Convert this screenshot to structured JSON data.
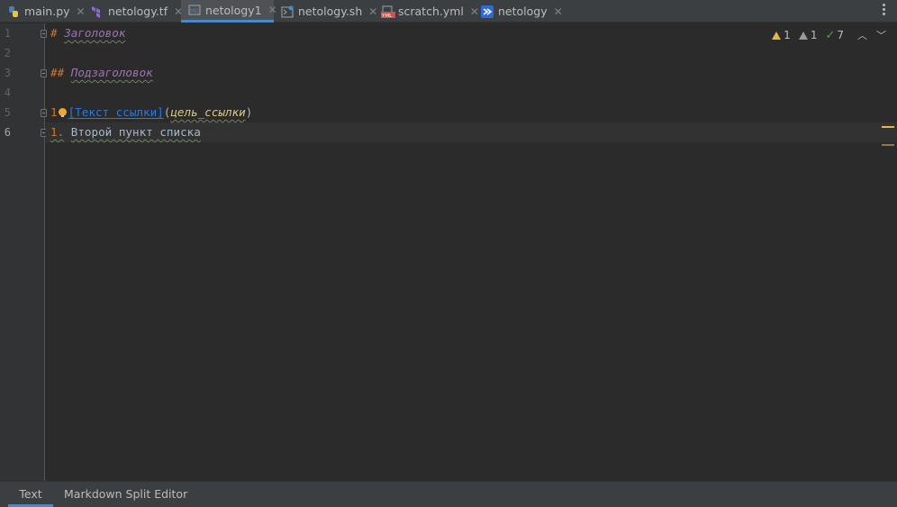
{
  "tabs": [
    {
      "label": "main.py",
      "icon": "python-file-icon",
      "active": false
    },
    {
      "label": "netology.tf",
      "icon": "terraform-file-icon",
      "active": false
    },
    {
      "label": "netology1",
      "icon": "markdown-file-icon",
      "active": true
    },
    {
      "label": "netology.sh",
      "icon": "shell-script-file-icon",
      "active": false
    },
    {
      "label": "scratch.yml",
      "icon": "yaml-file-icon",
      "active": false
    },
    {
      "label": "netology",
      "icon": "kubernetes-file-icon",
      "active": false
    }
  ],
  "editor": {
    "line_numbers": [
      "1",
      "2",
      "3",
      "4",
      "5",
      "6"
    ],
    "current_line": "6",
    "lines": {
      "l1_mark": "#",
      "l1_text": "Заголовок",
      "l3_mark": "##",
      "l3_text": "Подзаголовок",
      "l5_prefix": "1",
      "l5_link_text": "[Текст ссылки]",
      "l5_open": "(",
      "l5_url": "цель_ссылки",
      "l5_close": ")",
      "l6_num": "1.",
      "l6_text": "Второй пункт списка"
    }
  },
  "inspections": {
    "warnings": "1",
    "weak_warnings": "1",
    "typos": "7"
  },
  "bottom_tabs": {
    "text": "Text",
    "split": "Markdown Split Editor"
  },
  "colors": {
    "accent": "#4a88c7",
    "heading": "#9876aa",
    "markup": "#cc7832",
    "link": "#287bde",
    "warning": "#e5b54b"
  }
}
